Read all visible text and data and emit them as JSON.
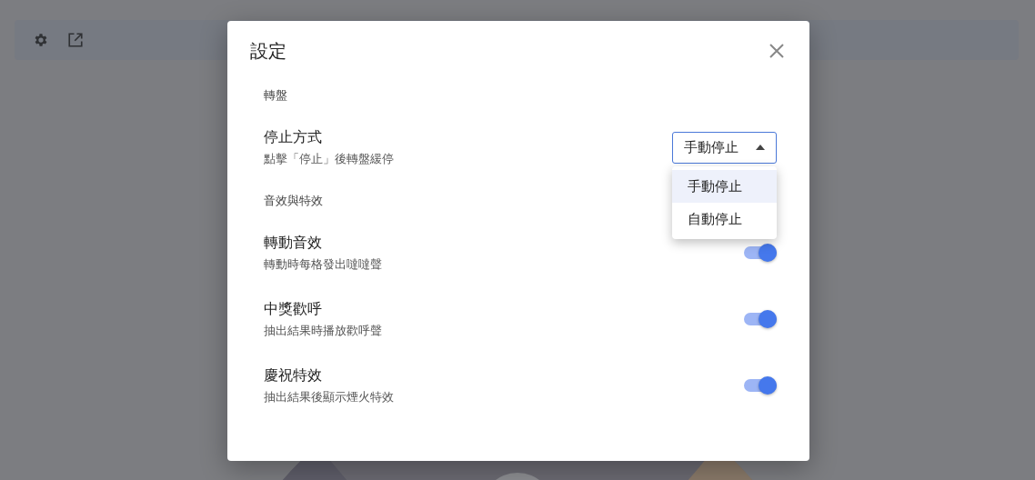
{
  "dialog": {
    "title": "設定",
    "sections": [
      {
        "heading": "轉盤",
        "settings": [
          {
            "kind": "select",
            "label": "停止方式",
            "description": "點擊「停止」後轉盤緩停",
            "value": "手動停止",
            "expanded": true,
            "options": [
              {
                "label": "手動停止",
                "selected": true
              },
              {
                "label": "自動停止",
                "selected": false
              }
            ]
          }
        ]
      },
      {
        "heading": "音效與特效",
        "settings": [
          {
            "kind": "toggle",
            "label": "轉動音效",
            "description": "轉動時每格發出噠噠聲",
            "on": true
          },
          {
            "kind": "toggle",
            "label": "中獎歡呼",
            "description": "抽出結果時播放歡呼聲",
            "on": true
          },
          {
            "kind": "toggle",
            "label": "慶祝特效",
            "description": "抽出結果後顯示煙火特效",
            "on": true
          }
        ]
      }
    ]
  }
}
